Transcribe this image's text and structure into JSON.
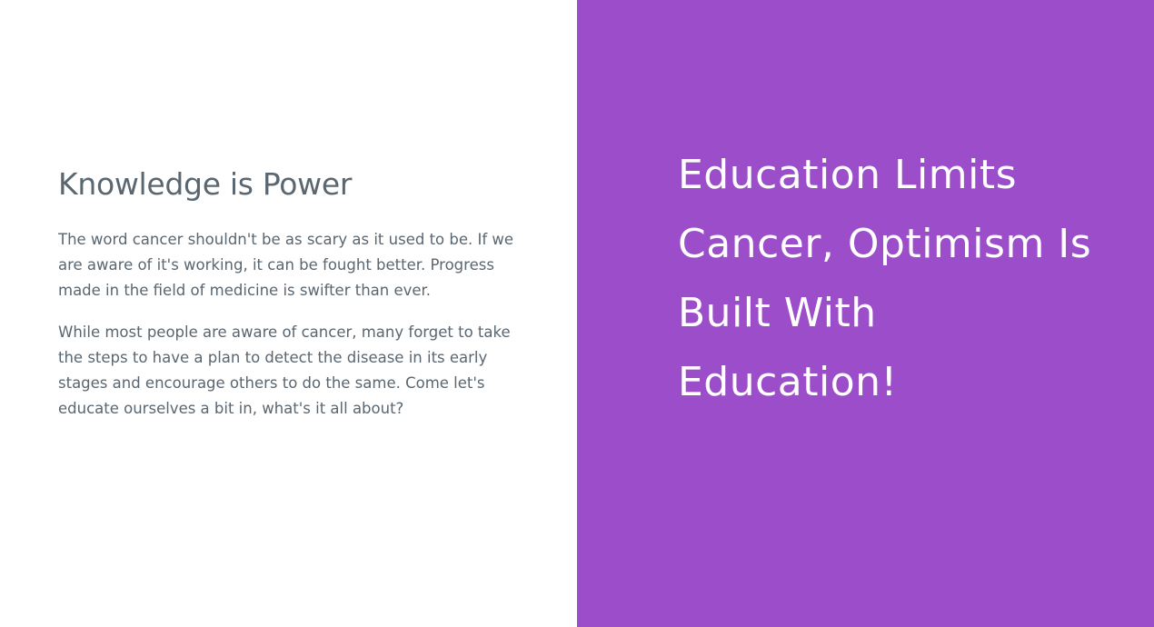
{
  "left": {
    "heading": "Knowledge is Power",
    "paragraph_1": "The word cancer shouldn't be as scary as it used to be. If we are aware of it's working, it can be fought better. Progress made in the field of medicine is swifter than ever.",
    "paragraph_2": "While most people are aware of cancer, many forget to take the steps to have a plan to detect the disease in its early stages and encourage others to do the same. Come let's educate ourselves a bit in, what's it all about?"
  },
  "right": {
    "quote": "Education Limits Cancer, Optimism Is Built With Education!"
  },
  "colors": {
    "accent": "#9b4dca",
    "text": "#5a6670",
    "quote_text": "#ffffff"
  }
}
